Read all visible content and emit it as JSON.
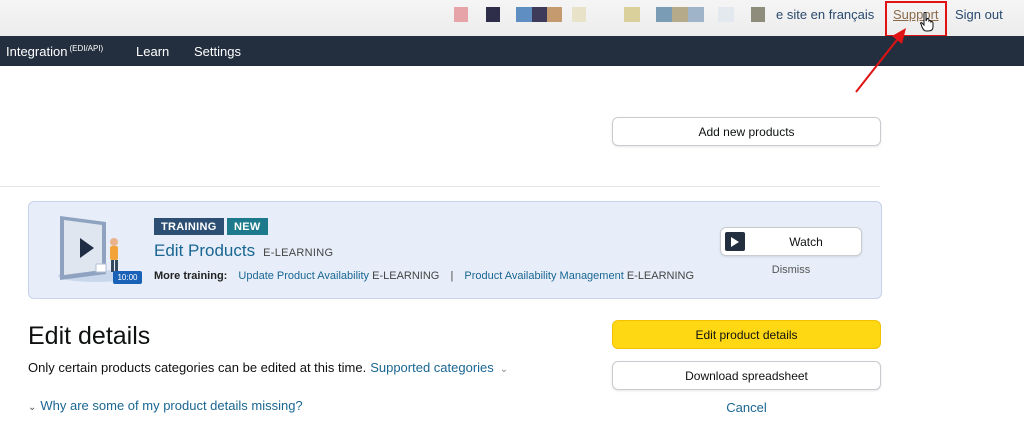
{
  "topbar": {
    "swatches": [
      "#e6a4a9",
      "#2f2e4a",
      "#5f8fc2",
      "#3d3a5a",
      "#c49a6e",
      "#e8e3c8",
      "#d9d09b",
      "#7a9cb4",
      "#b5ab8a",
      "#9fb4c8",
      "#e4e9ef",
      "#8e8c7a"
    ],
    "lang_link": "e site en français",
    "support_link": "Support",
    "signout_link": "Sign out"
  },
  "nav": {
    "integration": "Integration",
    "integration_sup": "(EDI/API)",
    "learn": "Learn",
    "settings": "Settings"
  },
  "actions": {
    "add_new_products": "Add new products"
  },
  "training": {
    "badge_training": "TRAINING",
    "badge_new": "NEW",
    "title": "Edit Products",
    "title_tag": "E-LEARNING",
    "duration": "10:00",
    "more_label": "More training:",
    "link1": "Update Product Availability",
    "link1_tag": "E-LEARNING",
    "separator": "|",
    "link2": "Product Availability Management",
    "link2_tag": "E-LEARNING",
    "watch": "Watch",
    "dismiss": "Dismiss"
  },
  "edit": {
    "heading": "Edit details",
    "description": "Only certain products categories can be edited at this time.",
    "supported_link": "Supported categories",
    "why_link": "Why are some of my product details missing?",
    "edit_btn": "Edit product details",
    "download_btn": "Download spreadsheet",
    "cancel": "Cancel"
  },
  "colors": {
    "nav_bg": "#232f3e",
    "primary_button": "#ffd814",
    "link": "#1a6692",
    "highlight": "#e01414"
  }
}
